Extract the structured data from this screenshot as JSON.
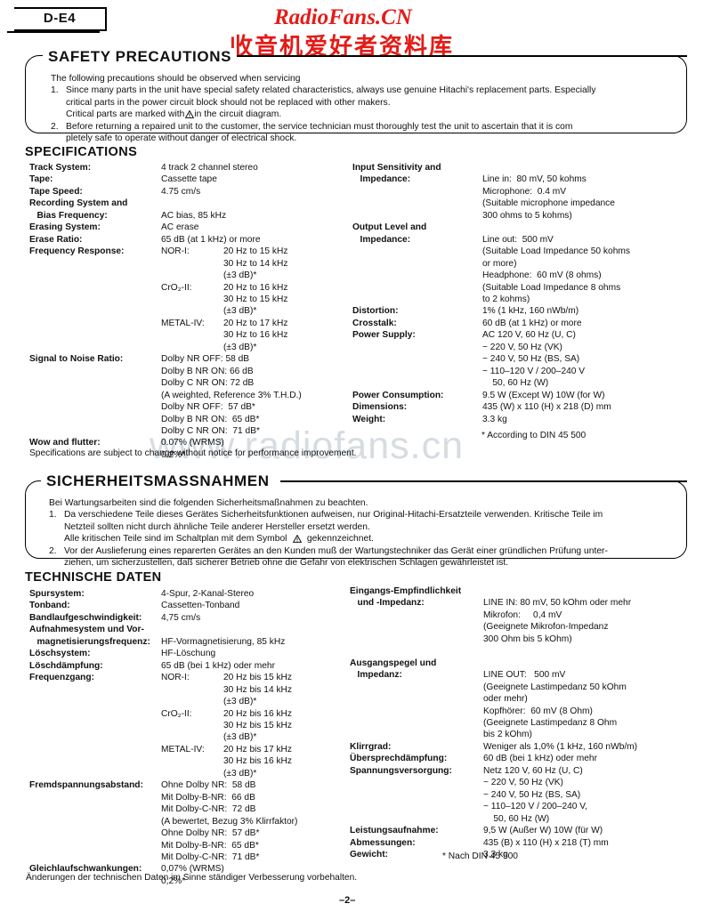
{
  "document": {
    "model": "D-E4",
    "page_number": "–2–"
  },
  "watermarks": {
    "brand_latin": "RadioFans.CN",
    "brand_cjk": "收音机爱好者资料库",
    "faint_url": "www.radiofans.cn",
    "brand_color": "#e41b17"
  },
  "safety_en": {
    "title": "SAFETY PRECAUTIONS",
    "intro": "The following precautions should be observed when servicing",
    "items": [
      {
        "num": "1.",
        "lines": [
          "Since many parts in the unit have special safety related characteristics, always use genuine Hitachi's replacement parts.  Especially",
          "critical parts in the power circuit block should not be replaced with other makers.",
          "Critical parts are marked with ⚠ in the circuit diagram."
        ]
      },
      {
        "num": "2.",
        "lines": [
          "Before returning a repaired unit to the customer, the service technician must thoroughly test the unit to ascertain that it is com",
          "pletely safe to operate without danger of electrical shock."
        ]
      }
    ]
  },
  "safety_de": {
    "title": "SICHERHEITSMASSNAHMEN",
    "intro": "Bei Wartungsarbeiten sind die folgenden Sicherheitsmaßnahmen zu beachten.",
    "items": [
      {
        "num": "1.",
        "lines": [
          "Da verschiedene Teile dieses Gerätes Sicherheitsfunktionen aufweisen, nur Original-Hitachi-Ersatzteile verwenden.  Kritische Teile im",
          "Netzteil sollten nicht durch ähnliche Teile anderer Hersteller ersetzt werden.",
          "Alle kritischen Teile sind im Schaltplan mit dem Symbol  ⚠   gekennzeichnet."
        ]
      },
      {
        "num": "2.",
        "lines": [
          "Vor der Auslieferung eines reparerten Gerätes an den Kunden muß der Wartungstechniker das Gerät einer gründlichen Prüfung unter-",
          "ziehen, um sicherzustellen, daß sicherer Betrieb ohne die Gefahr von elektrischen Schlagen gewährleistet ist."
        ]
      }
    ]
  },
  "specifications": {
    "heading": "SPECIFICATIONS",
    "left_rows": [
      {
        "label": "Track System:",
        "value": "4 track 2 channel stereo"
      },
      {
        "label": "Tape:",
        "value": "Cassette tape"
      },
      {
        "label": "Tape Speed:",
        "value": "4.75 cm/s"
      },
      {
        "label": "Recording System and",
        "value": ""
      },
      {
        "label": "   Bias Frequency:",
        "value": "AC bias, 85 kHz"
      },
      {
        "label": "Erasing System:",
        "value": "AC erase"
      },
      {
        "label": "Erase Ratio:",
        "value": "65 dB (at 1 kHz) or more"
      }
    ],
    "freq_label": "Frequency Response:",
    "freq_groups": [
      {
        "kind": "NOR-I:",
        "lines": [
          "20 Hz to 15 kHz",
          "30 Hz to 14 kHz",
          "(±3 dB)*"
        ]
      },
      {
        "kind": "CrO₂-II:",
        "lines": [
          "20 Hz to 16 kHz",
          "30 Hz to 15 kHz",
          "(±3 dB)*"
        ]
      },
      {
        "kind": "METAL-IV:",
        "lines": [
          "20 Hz to 17 kHz",
          "30 Hz to 16 kHz",
          "(±3 dB)*"
        ]
      }
    ],
    "snr_label": "Signal to Noise Ratio:",
    "snr_lines": [
      "Dolby NR OFF: 58 dB",
      "Dolby B NR ON: 66 dB",
      "Dolby C NR ON: 72 dB",
      "(A weighted, Reference 3% T.H.D.)",
      "Dolby NR OFF:  57 dB*",
      "Dolby B NR ON:  65 dB*",
      "Dolby C NR ON:  71 dB*"
    ],
    "wow_label": "Wow and flutter:",
    "wow_lines": [
      "0.07% (WRMS)",
      "0.2%*"
    ],
    "change_notice": "Specifications are subject to change without notice for performance improvement.",
    "right_rows": [
      {
        "label": "Input Sensitivity and",
        "value": ""
      },
      {
        "label": "   Impedance:",
        "value": "Line in:  80 mV, 50 kohms"
      }
    ],
    "input_extra": [
      "Microphone:  0.4 mV",
      "(Suitable microphone impedance",
      "300 ohms to 5 kohms)"
    ],
    "output_label_1": "Output Level and",
    "output_label_2": "   Impedance:",
    "output_lines": [
      "Line out:  500 mV",
      "(Suitable Load Impedance 50 kohms",
      "or more)",
      "Headphone:  60 mV (8 ohms)",
      "(Suitable Load Impedance 8 ohms",
      "to 2 kohms)"
    ],
    "tail_rows": [
      {
        "label": "Distortion:",
        "value": "1% (1 kHz, 160 nWb/m)"
      },
      {
        "label": "Crosstalk:",
        "value": "60 dB (at 1 kHz) or more"
      },
      {
        "label": "Power Supply:",
        "value": "AC 120 V, 60 Hz (U, C)"
      }
    ],
    "power_extra": [
      "~ 220 V, 50 Hz (VK)",
      "~ 240 V, 50 Hz (BS, SA)",
      "~ 110–120 V / 200–240 V",
      "    50, 60 Hz (W)"
    ],
    "tail_rows2": [
      {
        "label": "Power Consumption:",
        "value": "9.5 W (Except W) 10W (for W)"
      },
      {
        "label": "Dimensions:",
        "value": "435 (W) x 110 (H) x 218 (D) mm"
      },
      {
        "label": "Weight:",
        "value": "3.3 kg"
      }
    ],
    "din_note": "* According to DIN 45 500"
  },
  "technische_daten": {
    "heading": "TECHNISCHE  DATEN",
    "left_rows": [
      {
        "label": "Spursystem:",
        "value": "4-Spur, 2-Kanal-Stereo"
      },
      {
        "label": "Tonband:",
        "value": "Cassetten-Tonband"
      },
      {
        "label": "Bandlaufgeschwindigkeit:",
        "value": "4,75 cm/s"
      },
      {
        "label": "Aufnahmesystem und Vor-",
        "value": ""
      },
      {
        "label": "   magnetisierungsfrequenz:",
        "value": "HF-Vormagnetisierung, 85 kHz"
      },
      {
        "label": "Löschsystem:",
        "value": "HF-Löschung"
      },
      {
        "label": "Löschdämpfung:",
        "value": "65 dB (bei 1 kHz) oder mehr"
      }
    ],
    "freq_label": "Frequenzgang:",
    "freq_groups": [
      {
        "kind": "NOR-I:",
        "lines": [
          "20 Hz bis 15 kHz",
          "30 Hz bis 14 kHz",
          "(±3 dB)*"
        ]
      },
      {
        "kind": "CrO₂-II:",
        "lines": [
          "20 Hz bis 16 kHz",
          "30 Hz bis 15 kHz",
          "(±3 dB)*"
        ]
      },
      {
        "kind": "METAL-IV:",
        "lines": [
          "20 Hz bis 17 kHz",
          "30 Hz bis 16 kHz",
          "(±3 dB)*"
        ]
      }
    ],
    "snr_label": "Fremdspannungsabstand:",
    "snr_lines": [
      "Ohne Dolby NR:  58 dB",
      "Mit Dolby-B-NR:  66 dB",
      "Mit Dolby-C-NR:  72 dB",
      "(A bewertet, Bezug 3% Klirrfaktor)",
      "Ohne Dolby NR:  57 dB*",
      "Mit Dolby-B-NR:  65 dB*",
      "Mit Dolby-C-NR:  71 dB*"
    ],
    "wow_label": "Gleichlaufschwankungen:",
    "wow_lines": [
      "0,07% (WRMS)",
      "0,2%*"
    ],
    "change_notice": "Änderungen der technischen Daten im Sinne ständiger Verbesserung vorbehalten.",
    "right_label_1": "Eingangs-Empfindlichkeit",
    "right_label_2": "   und -Impedanz:",
    "input_lines": [
      "LINE IN: 80 mV, 50 kOhm oder mehr",
      "Mikrofon:     0,4 mV",
      "(Geeignete Mikrofon-Impedanz",
      "300 Ohm bis 5 kOhm)"
    ],
    "output_label_1": "Ausgangspegel und",
    "output_label_2": "   Impedanz:",
    "output_lines": [
      "LINE OUT:   500 mV",
      "(Geeignete Lastimpedanz 50 kOhm",
      "oder mehr)",
      "Kopfhörer:  60 mV (8 Ohm)",
      "(Geeignete Lastimpedanz 8 Ohm",
      "bis 2 kOhm)"
    ],
    "tail_rows": [
      {
        "label": "Klirrgrad:",
        "value": "Weniger als 1,0% (1 kHz, 160 nWb/m)"
      },
      {
        "label": "Übersprechdämpfung:",
        "value": "60 dB (bei 1 kHz) oder mehr"
      },
      {
        "label": "Spannungsversorgung:",
        "value": "Netz 120 V, 60 Hz (U, C)"
      }
    ],
    "power_extra": [
      "~ 220 V, 50 Hz (VK)",
      "~ 240 V, 50 Hz (BS, SA)",
      "~ 110–120 V / 200–240 V,",
      "    50, 60 Hz (W)"
    ],
    "tail_rows2": [
      {
        "label": "Leistungsaufnahme:",
        "value": "9,5 W (Außer W) 10W (für W)"
      },
      {
        "label": "Abmessungen:",
        "value": "435 (B) x 110 (H) x 218 (T) mm"
      },
      {
        "label": "Gewicht:",
        "value": "3,3 kg"
      }
    ],
    "din_note": "* Nach DIN 45 500"
  }
}
